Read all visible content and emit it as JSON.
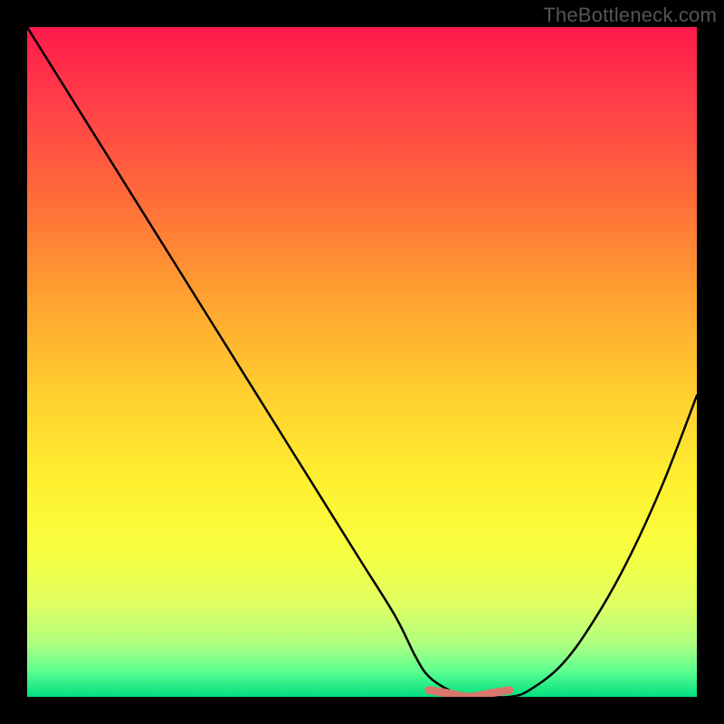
{
  "watermark": "TheBottleneck.com",
  "chart_data": {
    "type": "line",
    "title": "",
    "xlabel": "",
    "ylabel": "",
    "xlim": [
      0,
      100
    ],
    "ylim": [
      0,
      100
    ],
    "series": [
      {
        "name": "bottleneck-curve",
        "x": [
          0,
          5,
          10,
          15,
          20,
          25,
          30,
          35,
          40,
          45,
          50,
          55,
          58,
          60,
          63,
          66,
          69,
          72,
          75,
          80,
          85,
          90,
          95,
          100
        ],
        "values": [
          100,
          92,
          84,
          76,
          68,
          60,
          52,
          44,
          36,
          28,
          20,
          12,
          6,
          3,
          1,
          0,
          0,
          0,
          1,
          5,
          12,
          21,
          32,
          45
        ]
      },
      {
        "name": "flat-minimum-highlight",
        "x": [
          60,
          63,
          66,
          69,
          72
        ],
        "values": [
          1,
          0.5,
          0,
          0.5,
          1
        ]
      }
    ],
    "gradient_stops": [
      {
        "pos": 0,
        "color": "#ff1a4a"
      },
      {
        "pos": 25,
        "color": "#ff6a3a"
      },
      {
        "pos": 55,
        "color": "#ffd030"
      },
      {
        "pos": 78,
        "color": "#f8ff40"
      },
      {
        "pos": 100,
        "color": "#00e080"
      }
    ]
  }
}
